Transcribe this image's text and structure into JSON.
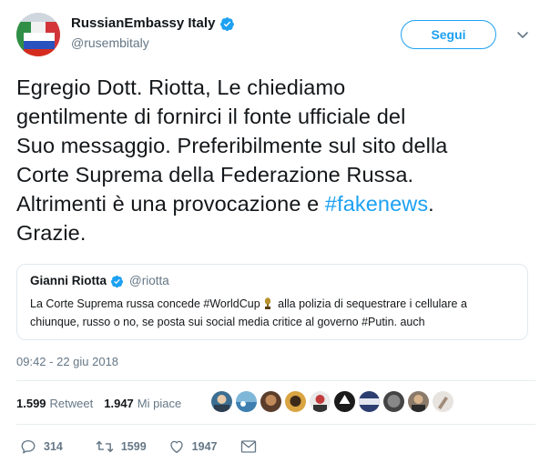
{
  "author": {
    "display_name": "RussianEmbassy Italy",
    "handle": "@rusembitaly"
  },
  "follow_button": "Segui",
  "tweet": {
    "lines": [
      "Egregio Dott. Riotta, Le chiediamo",
      "gentilmente di fornirci il fonte ufficiale del",
      "Suo messaggio. Preferibilmente sul sito della",
      "Corte Suprema della Federazione Russa."
    ],
    "line5_before": "Altrimenti è una provocazione e ",
    "line5_hashtag": "#fakenews",
    "line5_after": ".",
    "line6": "Grazie."
  },
  "quoted": {
    "display_name": "Gianni Riotta",
    "handle": "@riotta",
    "line1_before": "La Corte Suprema russa concede #WorldCup",
    "line1_after": " alla polizia di sequestrare i cellulare a",
    "line2": "chiunque, russo o no, se posta sui social media critice al governo #Putin. auch"
  },
  "timestamp": "09:42 - 22 giu 2018",
  "stats": {
    "retweets_count": "1.599",
    "retweets_label": "Retweet",
    "likes_count": "1.947",
    "likes_label": "Mi piace"
  },
  "actions": {
    "replies": "314",
    "retweets": "1599",
    "likes": "1947"
  },
  "icons": [
    "verified-icon",
    "chevron-down-icon",
    "trophy-icon",
    "reply-icon",
    "retweet-icon",
    "like-icon",
    "message-icon"
  ],
  "colors": {
    "accent": "#1da1f2",
    "secondary_text": "#657786",
    "border": "#e1e8ed"
  }
}
